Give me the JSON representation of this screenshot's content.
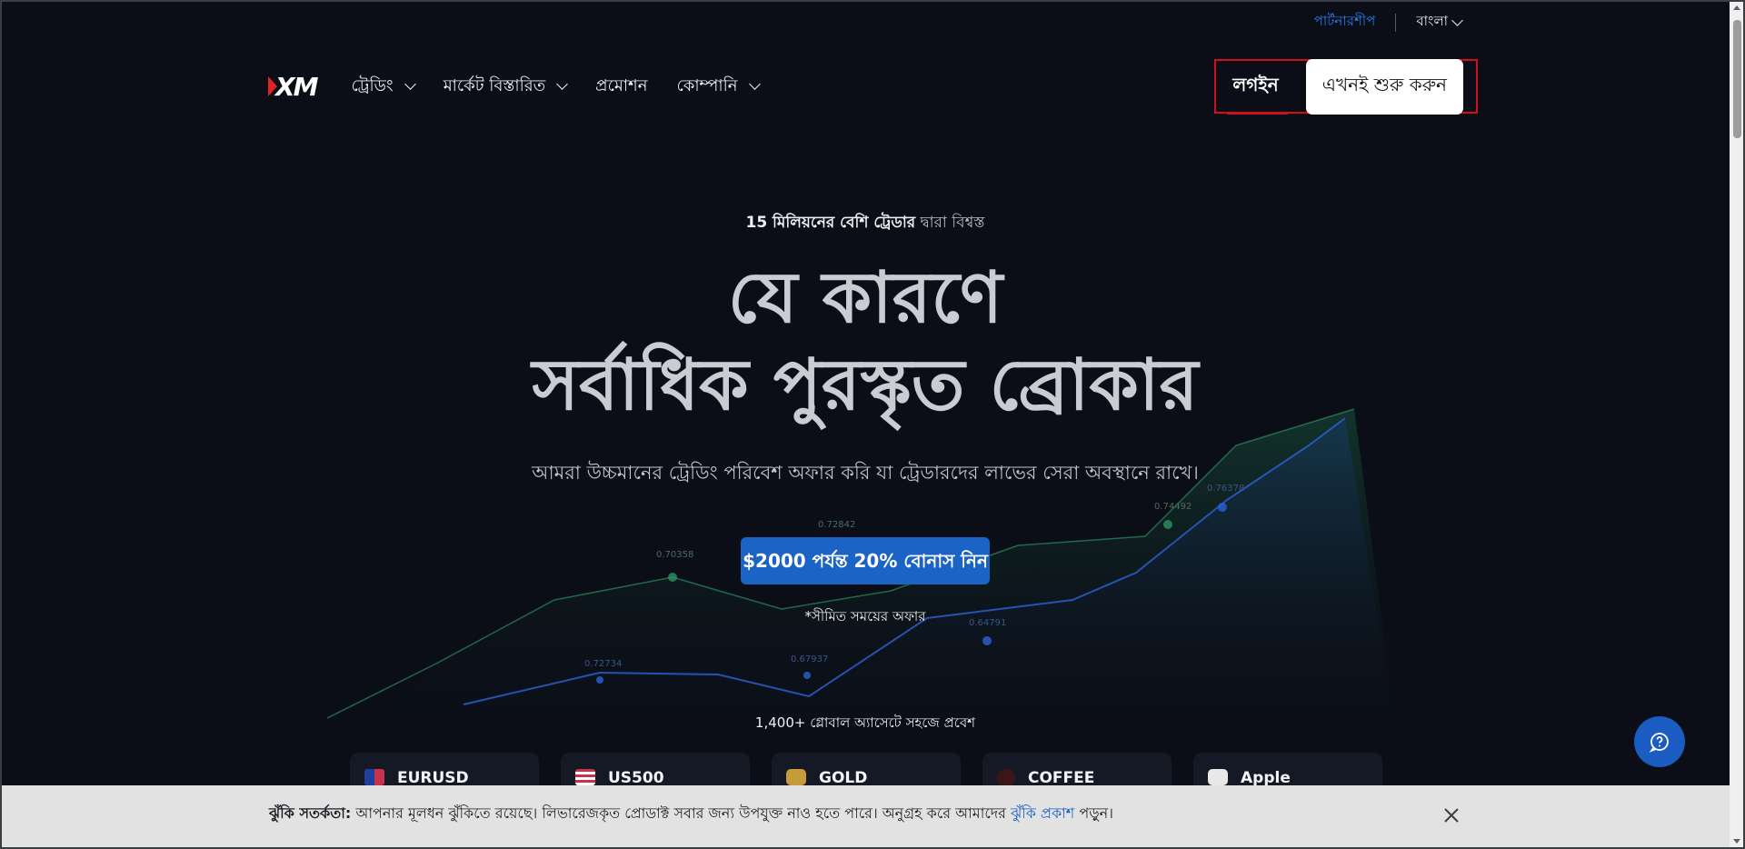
{
  "utility": {
    "partnership": "পার্টনারশীপ",
    "language": "বাংলা"
  },
  "nav": {
    "logo": "XM",
    "menu": [
      {
        "label": "ট্রেডিং",
        "has_dropdown": true
      },
      {
        "label": "মার্কেট বিস্তারিত",
        "has_dropdown": true
      },
      {
        "label": "প্রমোশন",
        "has_dropdown": false
      },
      {
        "label": "কোম্পানি",
        "has_dropdown": true
      }
    ],
    "login": "লগইন",
    "start_now": "এখনই শুরু করুন"
  },
  "hero": {
    "trust_bold": "15 মিলিয়নের বেশি ট্রেডার",
    "trust_rest": " দ্বারা বিশ্বস্ত",
    "title_line1": "যে কারণে",
    "title_line2": "সর্বাধিক পুরস্কৃত ব্রোকার",
    "subtitle": "আমরা উচ্চমানের ট্রেডিং পরিবেশ অফার করি যা ট্রেডারদের লাভের সেরা অবস্থানে রাখে।",
    "cta": "$2000 পর্যন্ত 20% বোনাস নিন",
    "limited_offer": "*সীমিত সময়ের অফার",
    "assets_access": "1,400+ গ্লোবাল অ্যাসেটে সহজে প্রবেশ"
  },
  "chart_labels": [
    "0.70358",
    "0.72842",
    "0.74492",
    "0.76378",
    "0.72734",
    "0.67937",
    "0.64791"
  ],
  "assets": [
    {
      "name": "EURUSD",
      "icon": "eu-us-flag-icon"
    },
    {
      "name": "US500",
      "icon": "us-flag-icon"
    },
    {
      "name": "GOLD",
      "icon": "gold-icon"
    },
    {
      "name": "COFFEE",
      "icon": "coffee-icon"
    },
    {
      "name": "Apple",
      "icon": "apple-icon"
    }
  ],
  "risk": {
    "label": "ঝুঁকি সতর্কতা:",
    "text": " আপনার মূলধন ঝুঁকিতে রয়েছে। লিভারেজকৃত প্রোডাক্ট সবার জন্য উপযুক্ত নাও হতে পারে। অনুগ্রহ করে আমাদের ",
    "link": "ঝুঁকি প্রকাশ",
    "after": " পড়ুন।"
  },
  "colors": {
    "accent_blue": "#1b63c4",
    "brand_red": "#e2222b",
    "highlight_red": "#d0101a"
  }
}
